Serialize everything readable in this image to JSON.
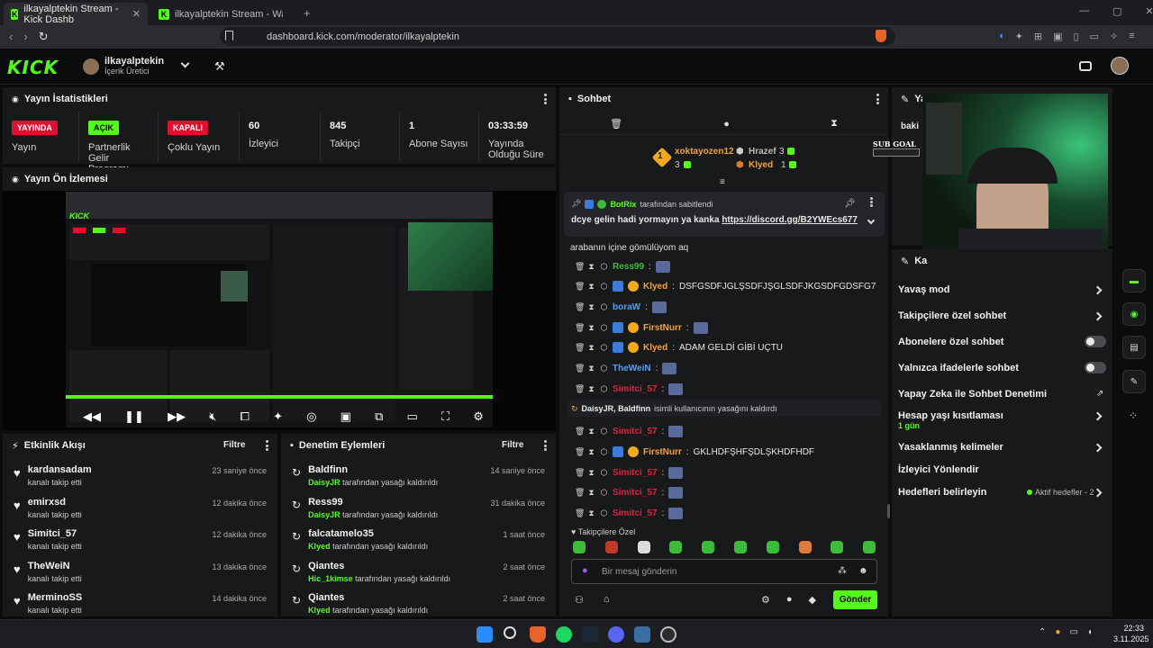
{
  "browser": {
    "tabs": [
      {
        "label": "ilkayalptekin Stream - Kick Dashb"
      },
      {
        "label": "ilkayalptekin Stream - Watch Live"
      }
    ],
    "url": "dashboard.kick.com/moderator/ilkayalptekin"
  },
  "header": {
    "username": "ilkayalptekin",
    "role": "İçerik Üretici",
    "logo": "KICK"
  },
  "stats": {
    "title": "Yayın İstatistikleri",
    "items": [
      {
        "badge": "YAYINDA",
        "label": "Yayın",
        "color": "#e0102f"
      },
      {
        "badge": "AÇIK",
        "label": "Partnerlik Gelir Programı",
        "color": "#53fc18"
      },
      {
        "badge": "KAPALI",
        "label": "Çoklu Yayın",
        "color": "#e0102f"
      },
      {
        "value": "60",
        "label": "İzleyici"
      },
      {
        "value": "845",
        "label": "Takipçi"
      },
      {
        "value": "1",
        "label": "Abone Sayısı"
      },
      {
        "value": "03:33:59",
        "label": "Yayında Olduğu Süre"
      }
    ]
  },
  "preview": {
    "title": "Yayın Ön İzlemesi"
  },
  "activity": {
    "title": "Etkinlik Akışı",
    "filter": "Filtre",
    "items": [
      {
        "name": "kardansadam",
        "sub": "kanalı takip etti",
        "time": "23 saniye önce"
      },
      {
        "name": "emirxsd",
        "sub": "kanalı takip etti",
        "time": "12 dakika önce"
      },
      {
        "name": "Simitci_57",
        "sub": "kanalı takip etti",
        "time": "12 dakika önce"
      },
      {
        "name": "TheWeiN",
        "sub": "kanalı takip etti",
        "time": "13 dakika önce"
      },
      {
        "name": "MerminoSS",
        "sub": "kanalı takip etti",
        "time": "14 dakika önce"
      }
    ]
  },
  "modlog": {
    "title": "Denetim Eylemleri",
    "filter": "Filtre",
    "suffix": "tarafından yasağı kaldırıldı",
    "items": [
      {
        "name": "Baldfinn",
        "by": "DaisyJR",
        "time": "14 saniye önce"
      },
      {
        "name": "Ress99",
        "by": "DaisyJR",
        "time": "31 dakika önce"
      },
      {
        "name": "falcatamelo35",
        "by": "Klyed",
        "time": "1 saat önce"
      },
      {
        "name": "Qiantes",
        "by": "Hic_1kimse",
        "time": "2 saat önce"
      },
      {
        "name": "Qiantes",
        "by": "Klyed",
        "time": "2 saat önce"
      }
    ]
  },
  "chat": {
    "title": "Sohbet",
    "leaders": [
      {
        "name": "xoktayozen12",
        "count": "3",
        "rank": "1"
      },
      {
        "name": "Hrazef",
        "count": "3"
      },
      {
        "name": "Klyed",
        "count": "1"
      }
    ],
    "pinned": {
      "by": "BotRix",
      "by_suffix": "tarafından sabitlendi",
      "text": "dcye gelin hadi yormayın ya kanka",
      "link": "https://discord.gg/B2YWEcs677"
    },
    "overflow": "arabanın içine gömülüyom aq",
    "messages": [
      {
        "user": "Ress99",
        "color": "#3dbb3a",
        "text": ""
      },
      {
        "user": "Klyed",
        "color": "#f2a33a",
        "text": "DSFGSDFJGLŞSDFJŞGLSDFJKGSDFGDSFG7"
      },
      {
        "user": "boraW",
        "color": "#4aa3ff",
        "text": ""
      },
      {
        "user": "FirstNurr",
        "color": "#f2a33a",
        "text": ""
      },
      {
        "user": "Klyed",
        "color": "#f2a33a",
        "text": "ADAM GELDİ GİBİ UÇTU"
      },
      {
        "user": "TheWeiN",
        "color": "#4aa3ff",
        "text": ""
      },
      {
        "user": "Simitci_57",
        "color": "#e0203f",
        "text": ""
      }
    ],
    "system": {
      "actor": "DaisyJR, Baldfinn",
      "text": "isimli kullanıcının yasağını kaldırdı"
    },
    "messages2": [
      {
        "user": "Simitci_57",
        "color": "#e0203f",
        "text": ""
      },
      {
        "user": "FirstNurr",
        "color": "#f2a33a",
        "text": "GKLHDFŞHFŞDLŞKHDFHDF"
      },
      {
        "user": "Simitci_57",
        "color": "#e0203f",
        "text": ""
      },
      {
        "user": "Simitci_57",
        "color": "#e0203f",
        "text": ""
      },
      {
        "user": "Simitci_57",
        "color": "#e0203f",
        "text": ""
      }
    ],
    "emote_label": "Takipçilere Özel",
    "input_placeholder": "Bir mesaj gönderin",
    "send": "Gönder"
  },
  "modpanel": {
    "items": [
      {
        "label": "Yavaş mod",
        "type": "chevron"
      },
      {
        "label": "Takipçilere özel sohbet",
        "type": "chevron"
      },
      {
        "label": "Abonelere özel sohbet",
        "type": "toggle"
      },
      {
        "label": "Yalnızca ifadelerle sohbet",
        "type": "toggle"
      },
      {
        "label": "Yapay Zeka ile Sohbet Denetimi",
        "type": "external"
      },
      {
        "label": "Hesap yaşı kısıtlaması",
        "sub": "1 gün",
        "type": "chevron"
      },
      {
        "label": "Yasaklanmış kelimeler",
        "type": "chevron"
      },
      {
        "label": "İzleyici Yönlendir",
        "type": "none"
      },
      {
        "label": "Hedefleri belirleyin",
        "status": "Aktif hedefler - 2",
        "type": "chevron"
      }
    ],
    "header_partial": "Ka",
    "top_partial": "Yay",
    "top_text_partial": "baki",
    "sub_goal": "SUB GOAL"
  },
  "taskbar": {
    "time": "22:33",
    "date": "3.11.2025"
  }
}
